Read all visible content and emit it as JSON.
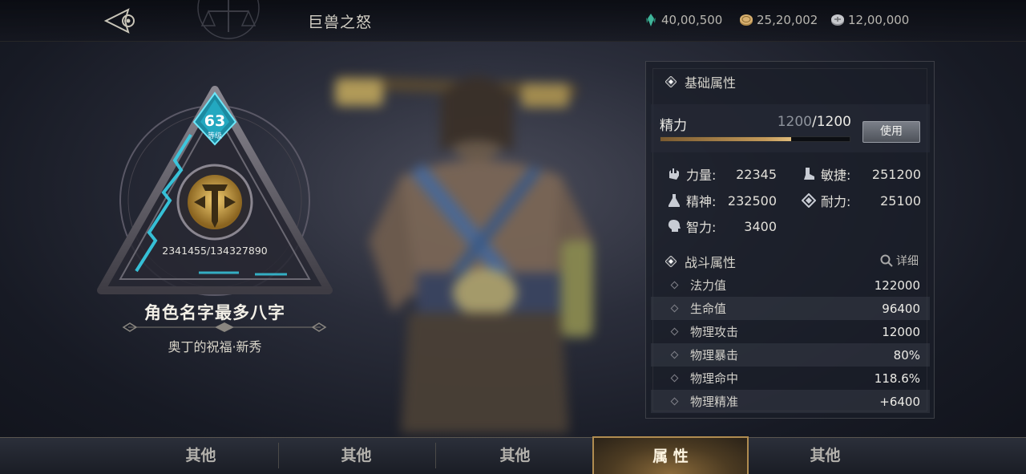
{
  "header": {
    "title": "巨兽之怒",
    "currencies": [
      {
        "icon": "green-crystal-icon",
        "value": "40,00,500"
      },
      {
        "icon": "gold-coin-icon",
        "value": "25,20,002"
      },
      {
        "icon": "silver-coin-icon",
        "value": "12,00,000"
      }
    ]
  },
  "character": {
    "level": "63",
    "level_label": "等级",
    "exp": "2341455/134327890",
    "name": "角色名字最多八字",
    "title": "奥丁的祝福·新秀"
  },
  "panel": {
    "basic_header": "基础属性",
    "energy": {
      "label": "精力",
      "current": "1200",
      "max": "/1200",
      "fill": 0.69,
      "use_label": "使用"
    },
    "stats": [
      {
        "icon": "fist-icon",
        "label": "力量:",
        "value": "22345"
      },
      {
        "icon": "boot-icon",
        "label": "敏捷:",
        "value": "251200"
      },
      {
        "icon": "flask-icon",
        "label": "精神:",
        "value": "232500"
      },
      {
        "icon": "shield-diamond-icon",
        "label": "耐力:",
        "value": "25100"
      },
      {
        "icon": "brain-head-icon",
        "label": "智力:",
        "value": "3400"
      }
    ],
    "combat_header": "战斗属性",
    "detail_label": "详细",
    "combat": [
      {
        "label": "法力值",
        "value": "122000"
      },
      {
        "label": "生命值",
        "value": "96400"
      },
      {
        "label": "物理攻击",
        "value": "12000"
      },
      {
        "label": "物理暴击",
        "value": "80%"
      },
      {
        "label": "物理命中",
        "value": "118.6%"
      },
      {
        "label": "物理精准",
        "value": "+6400"
      }
    ]
  },
  "tabs": [
    {
      "label": "其他",
      "active": false
    },
    {
      "label": "其他",
      "active": false
    },
    {
      "label": "其他",
      "active": false
    },
    {
      "label": "属 性",
      "active": true
    },
    {
      "label": "其他",
      "active": false
    }
  ],
  "colors": {
    "accent_gold": "#c49a5a",
    "cyan_rune": "#38d0e8",
    "panel_bg": "#1a1e28"
  }
}
